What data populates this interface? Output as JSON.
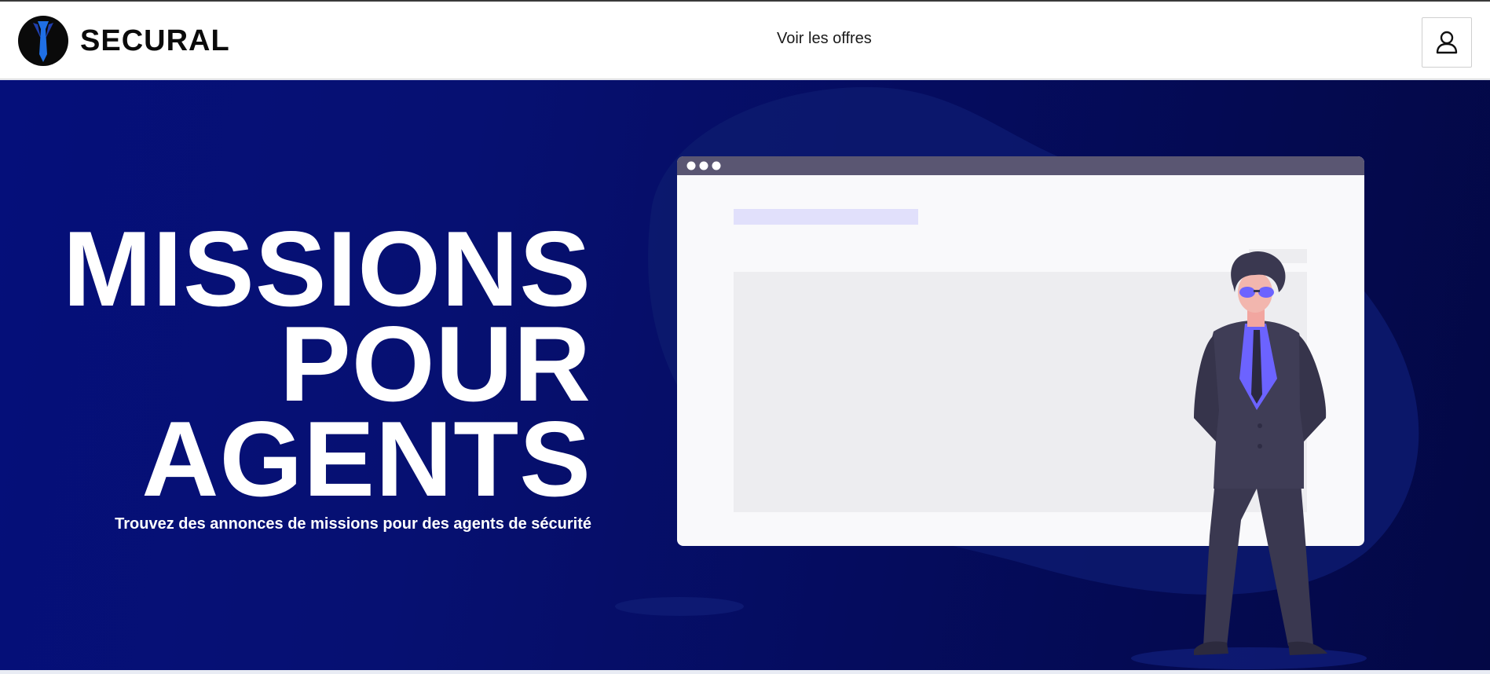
{
  "brand": {
    "name": "SECURAL",
    "logo_icon": "tie-logo-icon"
  },
  "nav": {
    "offers_link": "Voir les offres",
    "account_icon": "user-icon"
  },
  "hero": {
    "headline_lines": [
      "MISSIONS",
      "POUR",
      "AGENTS"
    ],
    "subtitle": "Trouvez des annonces de missions pour des agents de sécurité",
    "illustration": "security-agent-in-front-of-browser-window"
  },
  "colors": {
    "hero_background": "#050f7a",
    "accent": "#6c63ff",
    "logo_blue": "#1f6fe5",
    "suit": "#3f3d56"
  }
}
